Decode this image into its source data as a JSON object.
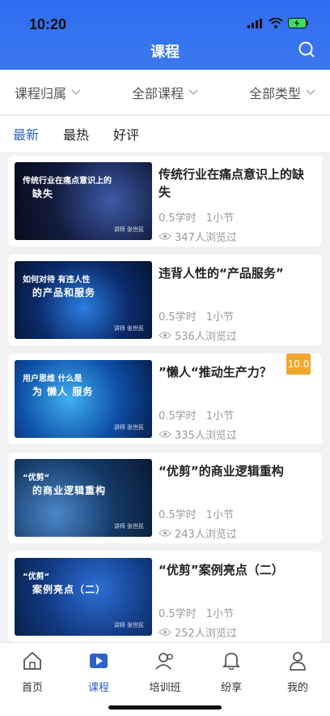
{
  "status_bar": {
    "time": "10:20"
  },
  "header": {
    "title": "课程"
  },
  "filters": [
    {
      "label": "课程归属"
    },
    {
      "label": "全部课程"
    },
    {
      "label": "全部类型"
    }
  ],
  "sort_tabs": [
    {
      "label": "最新",
      "active": true
    },
    {
      "label": "最热",
      "active": false
    },
    {
      "label": "好评",
      "active": false
    }
  ],
  "courses": [
    {
      "title": "传统行业在痛点意识上的缺失",
      "hours": "0.5学时",
      "sections": "1小节",
      "views": "347人浏览过",
      "thumb_line1": "传统行业在痛点意识上的",
      "thumb_line2": "缺失",
      "lecturer": "讲师 张世民"
    },
    {
      "title": "违背人性的“产品服务”",
      "hours": "0.5学时",
      "sections": "1小节",
      "views": "536人浏览过",
      "thumb_line1": "如何对待 有违人性",
      "thumb_line2": "的产品和服务",
      "lecturer": "讲师 张世民"
    },
    {
      "title": "”懒人“推动生产力？",
      "hours": "0.5学时",
      "sections": "1小节",
      "views": "335人浏览过",
      "thumb_line1": "用户思维 什么是",
      "thumb_line2": "为 懒人 服务",
      "lecturer": "讲师 张世民",
      "badge": "10.0"
    },
    {
      "title": "“优剪”的商业逻辑重构",
      "hours": "0.5学时",
      "sections": "1小节",
      "views": "243人浏览过",
      "thumb_line1": "“优剪“",
      "thumb_line2": "的商业逻辑重构",
      "lecturer": "讲师 张世民"
    },
    {
      "title": "“优剪”案例亮点（二）",
      "hours": "0.5学时",
      "sections": "1小节",
      "views": "252人浏览过",
      "thumb_line1": "“优剪“",
      "thumb_line2": "案例亮点（二）",
      "lecturer": "讲师 张世民"
    }
  ],
  "tabbar": [
    {
      "label": "首页",
      "icon": "home-icon"
    },
    {
      "label": "课程",
      "icon": "play-icon",
      "active": true
    },
    {
      "label": "培训班",
      "icon": "users-icon"
    },
    {
      "label": "纷享",
      "icon": "bell-icon"
    },
    {
      "label": "我的",
      "icon": "person-icon"
    }
  ],
  "colors": {
    "accent": "#2f62c8",
    "header": "#3b78ee",
    "badge": "#f2a62b"
  }
}
